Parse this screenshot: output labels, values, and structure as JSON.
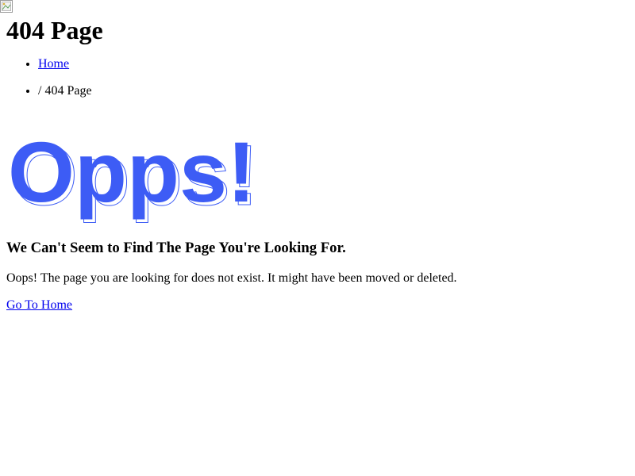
{
  "page_title": "404 Page",
  "breadcrumb": {
    "home_label": "Home",
    "current_label": "/ 404 Page"
  },
  "error_graphic": {
    "text": "Opps!",
    "fill_color": "#3d5cf5",
    "outline_color": "#3d5cf5"
  },
  "subtitle": "We Can't Seem to Find The Page You're Looking For.",
  "message": "Oops! The page you are looking for does not exist. It might have been moved or deleted.",
  "go_home_label": "Go To Home",
  "colors": {
    "link": "#0000ee",
    "text": "#000000",
    "accent": "#3d5cf5"
  }
}
